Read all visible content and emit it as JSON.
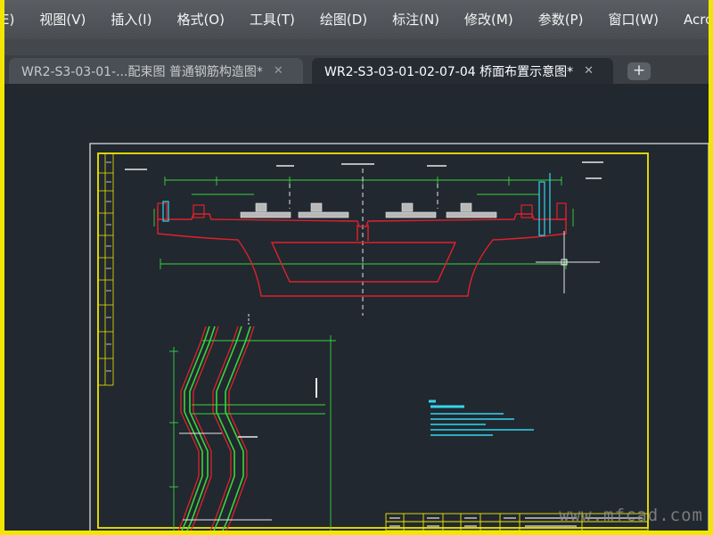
{
  "menu": {
    "items": [
      "E)",
      "视图(V)",
      "插入(I)",
      "格式(O)",
      "工具(T)",
      "绘图(D)",
      "标注(N)",
      "修改(M)",
      "参数(P)",
      "窗口(W)",
      "Acroba"
    ]
  },
  "tabs": [
    {
      "label": "WR2-S3-03-01-...配束图 普通钢筋构造图*",
      "close": "✕",
      "active": false
    },
    {
      "label": "WR2-S3-03-01-02-07-04 桥面布置示意图*",
      "close": "✕",
      "active": true
    }
  ],
  "new_tab_label": "+",
  "watermark": "www.mfcad.com",
  "colors": {
    "background": "#212830",
    "border_yellow": "#f2e600",
    "drawing_green": "#3bd43b",
    "drawing_red": "#e0212b",
    "drawing_white": "#e8e8e8",
    "drawing_cyan": "#33d6f0"
  }
}
